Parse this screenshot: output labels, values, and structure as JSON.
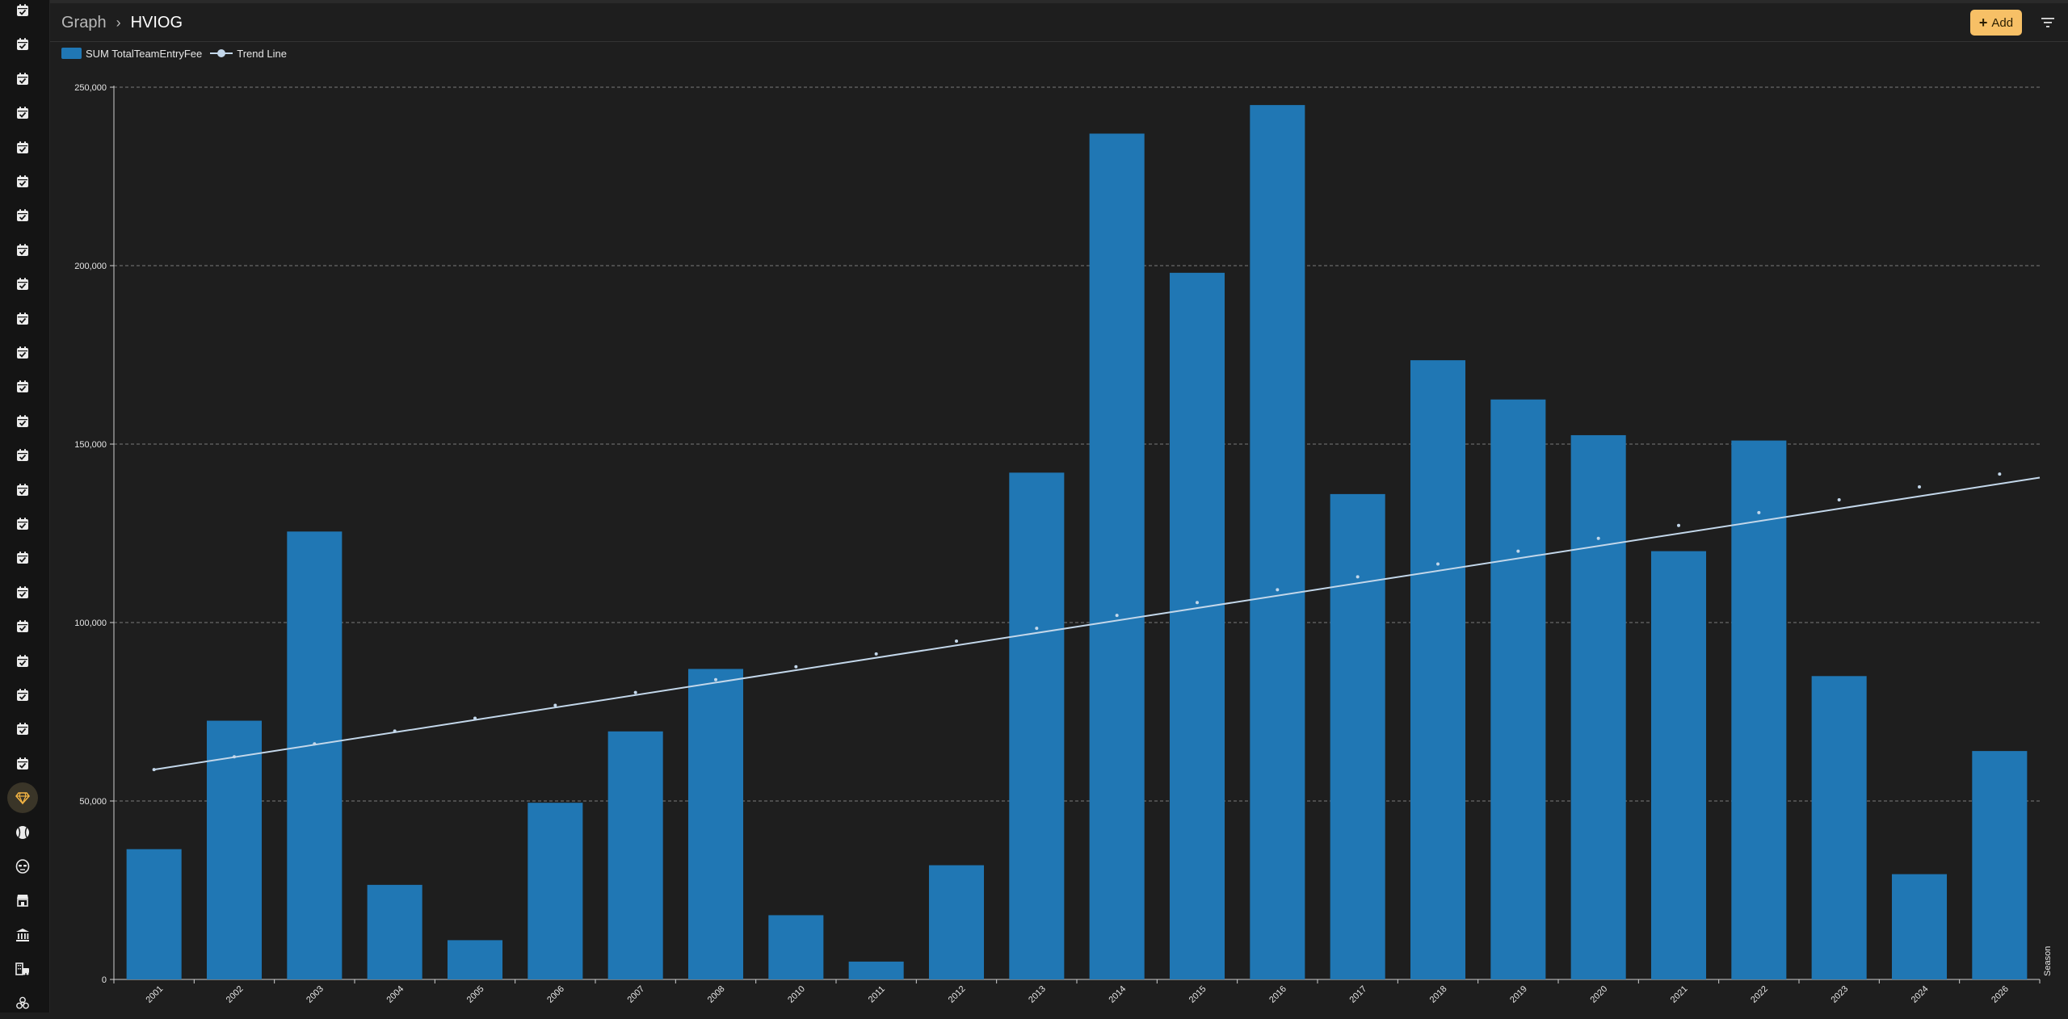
{
  "header": {
    "breadcrumb_root": "Graph",
    "breadcrumb_separator": "›",
    "breadcrumb_current": "HVIOG",
    "add_label": "Add",
    "add_icon": "plus-icon",
    "filter_icon": "filter-icon"
  },
  "sidebar": {
    "items": [
      {
        "icon": "calendar-check-icon"
      },
      {
        "icon": "calendar-check-icon"
      },
      {
        "icon": "calendar-check-icon"
      },
      {
        "icon": "calendar-check-icon"
      },
      {
        "icon": "calendar-check-icon"
      },
      {
        "icon": "calendar-check-icon"
      },
      {
        "icon": "calendar-check-icon"
      },
      {
        "icon": "calendar-check-icon"
      },
      {
        "icon": "calendar-check-icon"
      },
      {
        "icon": "calendar-check-icon"
      },
      {
        "icon": "calendar-check-icon"
      },
      {
        "icon": "calendar-check-icon"
      },
      {
        "icon": "calendar-check-icon"
      },
      {
        "icon": "calendar-check-icon"
      },
      {
        "icon": "calendar-check-icon"
      },
      {
        "icon": "calendar-check-icon"
      },
      {
        "icon": "calendar-check-icon"
      },
      {
        "icon": "calendar-check-icon"
      },
      {
        "icon": "calendar-check-icon"
      },
      {
        "icon": "calendar-check-icon"
      },
      {
        "icon": "calendar-check-icon"
      },
      {
        "icon": "calendar-check-icon"
      },
      {
        "icon": "calendar-check-icon"
      },
      {
        "icon": "gem-icon",
        "active": true
      },
      {
        "icon": "baseball-icon"
      },
      {
        "icon": "mask-icon"
      },
      {
        "icon": "shop-icon"
      },
      {
        "icon": "bank-icon"
      },
      {
        "icon": "bus-building-icon"
      },
      {
        "icon": "biohazard-icon"
      }
    ]
  },
  "colors": {
    "bar": "#2077b4",
    "trend": "#c3d7ea",
    "accent": "#f7c066",
    "active_icon": "#f5b544",
    "icon": "#ececec",
    "grid": "#7a7a7a",
    "axis": "#cfcfcf"
  },
  "chart_data": {
    "type": "bar",
    "categories": [
      "2001",
      "2002",
      "2003",
      "2004",
      "2005",
      "2006",
      "2007",
      "2008",
      "2010",
      "2011",
      "2012",
      "2013",
      "2014",
      "2015",
      "2016",
      "2017",
      "2018",
      "2019",
      "2020",
      "2021",
      "2022",
      "2023",
      "2024",
      "2026"
    ],
    "series": [
      {
        "name": "SUM TotalTeamEntryFee",
        "type": "bar",
        "values": [
          36500,
          72500,
          125500,
          26500,
          11000,
          49500,
          69500,
          87000,
          18000,
          5000,
          32000,
          142000,
          237000,
          198000,
          245000,
          136000,
          173500,
          162500,
          152500,
          120000,
          151000,
          85000,
          29500,
          64000
        ]
      },
      {
        "name": "Trend Line",
        "type": "line",
        "values": [
          58800,
          62400,
          66000,
          69600,
          73200,
          76800,
          80400,
          84000,
          87600,
          91200,
          94800,
          98400,
          102000,
          105600,
          109200,
          112800,
          116400,
          120000,
          123600,
          127200,
          130800,
          134400,
          138000,
          141600
        ],
        "trend_start": 58800,
        "trend_end": 140600
      }
    ],
    "y_ticks": [
      "0",
      "50,000",
      "100,000",
      "150,000",
      "200,000",
      "250,000"
    ],
    "y_tick_values": [
      0,
      50000,
      100000,
      150000,
      200000,
      250000
    ],
    "ylim": [
      0,
      250000
    ],
    "xlabel": "Season",
    "ylabel": "",
    "grid": "horizontal-dashed",
    "legend": "top-left"
  }
}
